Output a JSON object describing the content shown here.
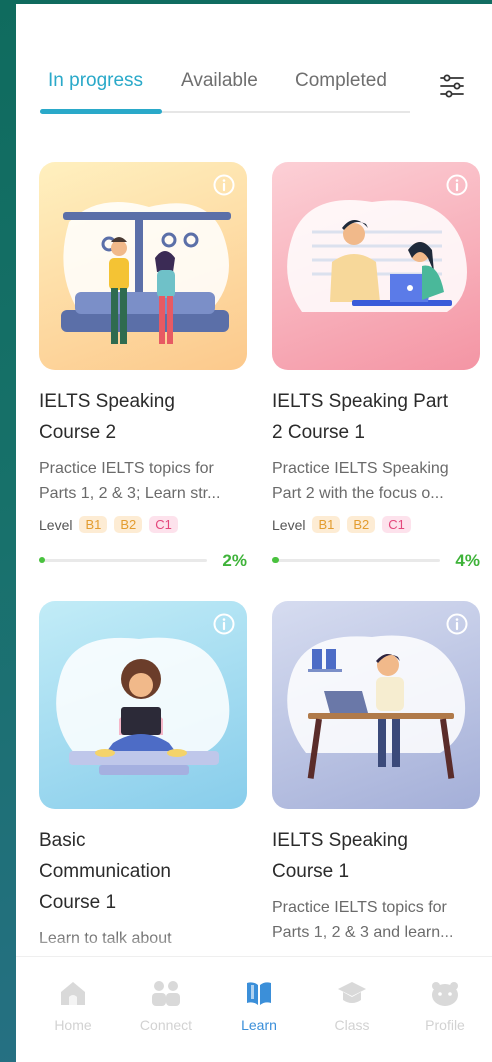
{
  "tabs": [
    {
      "label": "In progress",
      "active": true
    },
    {
      "label": "Available",
      "active": false
    },
    {
      "label": "Completed",
      "active": false
    }
  ],
  "filter_icon": "sliders-icon",
  "level_label": "Level",
  "levels": [
    "B1",
    "B2",
    "C1"
  ],
  "courses": [
    {
      "title_lines": [
        "IELTS Speaking",
        "Course 2"
      ],
      "desc_lines": [
        "Practice IELTS topics for",
        "Parts 1, 2 & 3; Learn str..."
      ],
      "progress_label": "2%",
      "progress": 0.02,
      "thumb_colors": [
        "#fde9a8",
        "#fbc98f"
      ],
      "illustration": "subway-commuters-illustration"
    },
    {
      "title_lines": [
        "IELTS Speaking Part",
        "2 Course 1"
      ],
      "desc_lines": [
        "Practice IELTS Speaking",
        "Part 2 with the focus o..."
      ],
      "progress_label": "4%",
      "progress": 0.04,
      "thumb_colors": [
        "#fbc3cc",
        "#f49aa8"
      ],
      "illustration": "laptop-conversation-illustration"
    },
    {
      "title_lines": [
        "Basic",
        "Communication",
        "Course 1"
      ],
      "desc_lines": [
        "Learn to talk about"
      ],
      "thumb_colors": [
        "#b6e6f3",
        "#8fd0ea"
      ],
      "illustration": "girl-with-laptop-illustration"
    },
    {
      "title_lines": [
        "IELTS Speaking",
        "Course 1"
      ],
      "desc_lines": [
        "Practice IELTS topics for",
        "Parts 1, 2 & 3 and learn..."
      ],
      "thumb_colors": [
        "#cdd6ee",
        "#a9b4dc"
      ],
      "illustration": "desk-worker-illustration"
    }
  ],
  "nav": [
    {
      "label": "Home",
      "icon": "home-icon",
      "active": false
    },
    {
      "label": "Connect",
      "icon": "people-icon",
      "active": false
    },
    {
      "label": "Learn",
      "icon": "book-icon",
      "active": true
    },
    {
      "label": "Class",
      "icon": "graduation-cap-icon",
      "active": false
    },
    {
      "label": "Profile",
      "icon": "profile-face-icon",
      "active": false
    }
  ],
  "colors": {
    "accent": "#2aa9c9",
    "progress": "#49c23e",
    "nav_active": "#3b8fd9",
    "nav_inactive": "#d2d2d2"
  }
}
